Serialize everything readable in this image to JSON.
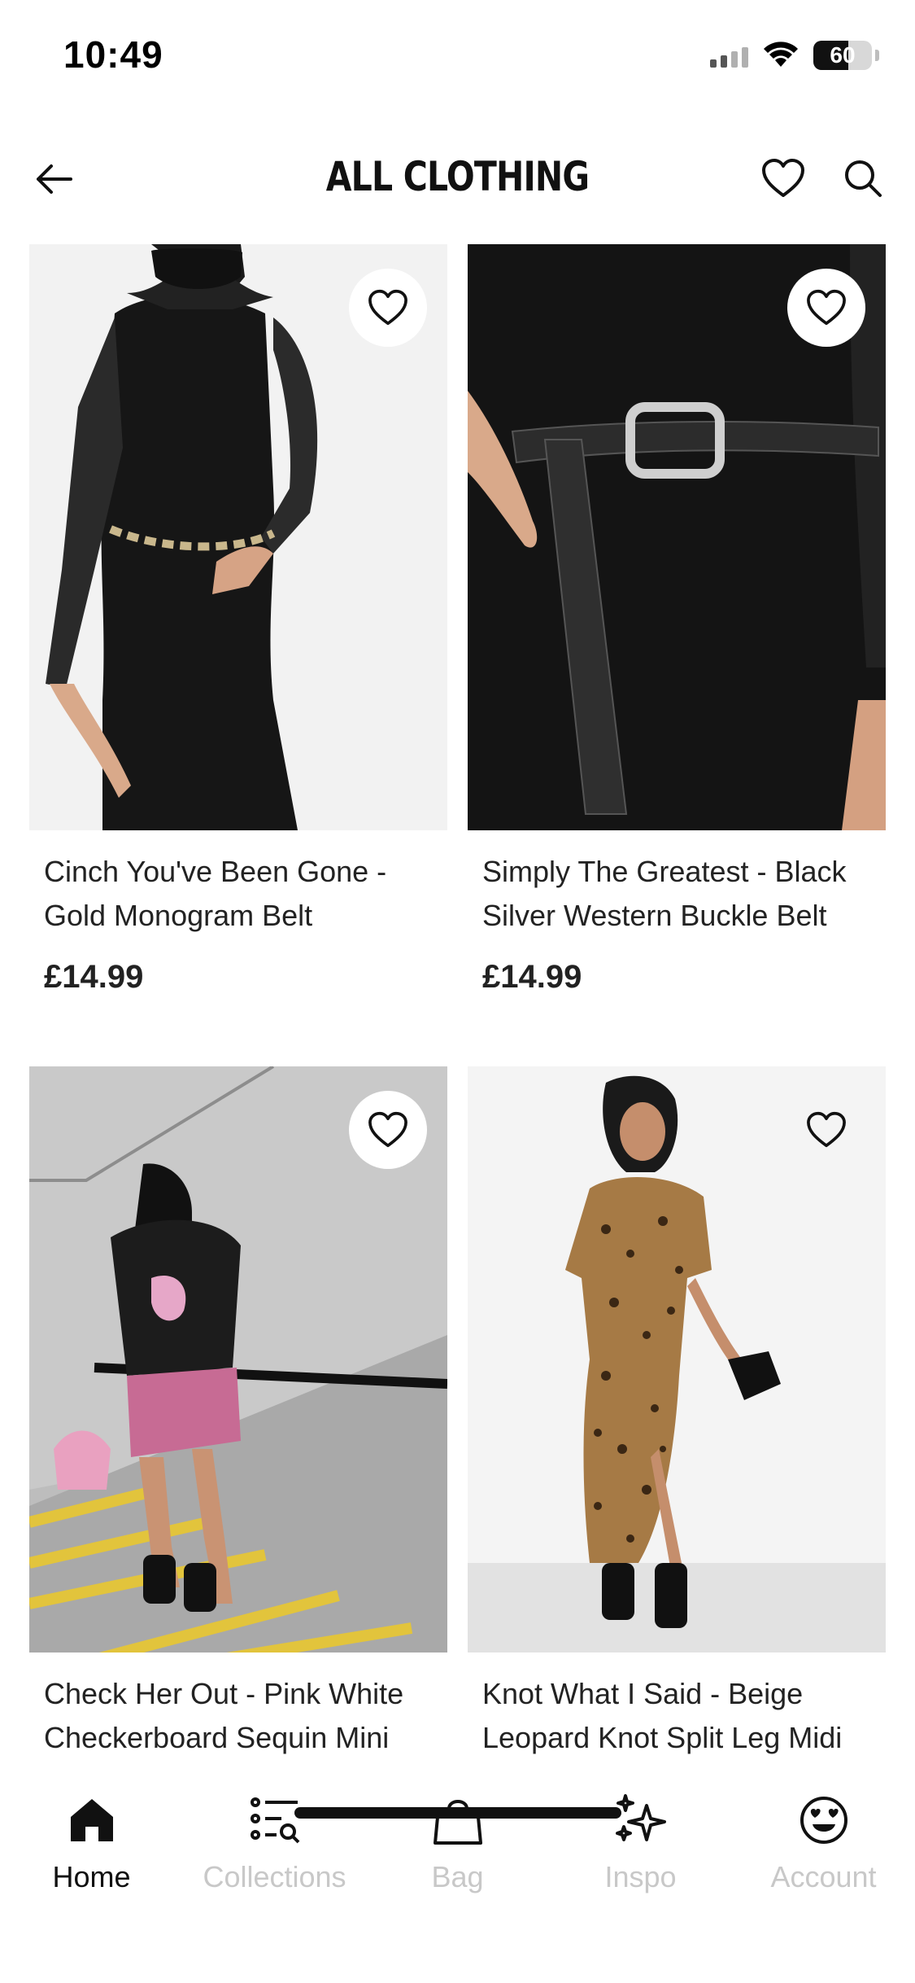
{
  "status_bar": {
    "time": "10:49",
    "battery": "60",
    "battery_fraction": 0.6
  },
  "header": {
    "title": "ALL CLOTHING",
    "icons": [
      "arrow-left-icon",
      "heart-icon",
      "search-icon"
    ]
  },
  "products": [
    {
      "name": "Cinch You've Been Gone - Gold Monogram Belt",
      "price": "£14.99"
    },
    {
      "name": "Simply The Greatest - Black Silver Western Buckle Belt",
      "price": "£14.99"
    },
    {
      "name": "Check Her Out - Pink White Checkerboard Sequin Mini",
      "price": ""
    },
    {
      "name": "Knot What I Said - Beige Leopard Knot Split Leg Midi",
      "price": ""
    }
  ],
  "bottom_nav": [
    {
      "label": "Home",
      "icon": "home-icon",
      "active": true
    },
    {
      "label": "Collections",
      "icon": "collections-icon",
      "active": false
    },
    {
      "label": "Bag",
      "icon": "bag-icon",
      "active": false
    },
    {
      "label": "Inspo",
      "icon": "sparkles-icon",
      "active": false
    },
    {
      "label": "Account",
      "icon": "smiley-heart-eyes-icon",
      "active": false
    }
  ],
  "colors": {
    "text": "#1a1a1a",
    "inactive_nav": "#c8c8c8",
    "background": "#ffffff"
  }
}
